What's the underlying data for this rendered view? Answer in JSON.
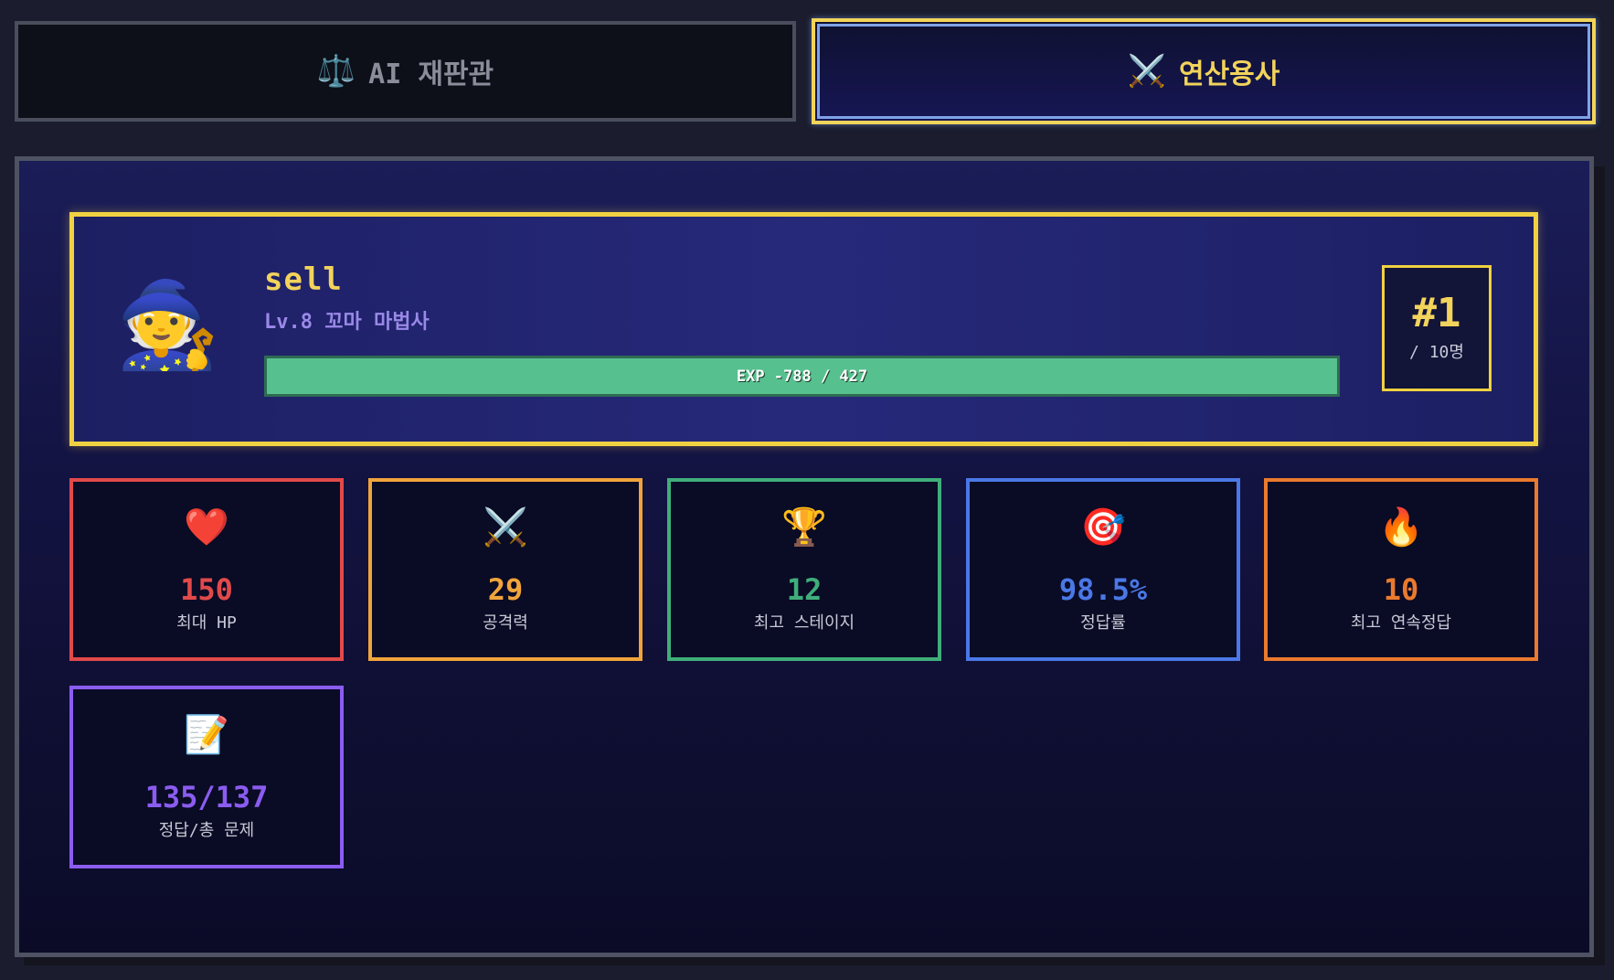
{
  "tabs": {
    "judge": {
      "icon": "⚖️",
      "label": "AI 재판관"
    },
    "warrior": {
      "icon": "⚔️",
      "label": "연산용사"
    }
  },
  "profile": {
    "avatar": "🧙",
    "username": "sell",
    "level": "Lv.8 꼬마 마법사",
    "exp_text": "EXP -788 / 427",
    "exp_fill_ratio": 1.0,
    "rank": "#1",
    "rank_total": "/ 10명"
  },
  "stats": [
    {
      "icon": "❤️",
      "value": "150",
      "label": "최대 HP",
      "color": "#e14a4a"
    },
    {
      "icon": "⚔️",
      "value": "29",
      "label": "공격력",
      "color": "#f0a43a"
    },
    {
      "icon": "🏆",
      "value": "12",
      "label": "최고 스테이지",
      "color": "#3fae7a"
    },
    {
      "icon": "🎯",
      "value": "98.5%",
      "label": "정답률",
      "color": "#4a78e6"
    },
    {
      "icon": "🔥",
      "value": "10",
      "label": "최고 연속정답",
      "color": "#ea7a2e"
    },
    {
      "icon": "📝",
      "value": "135/137",
      "label": "정답/총 문제",
      "color": "#8b5cf0"
    }
  ]
}
